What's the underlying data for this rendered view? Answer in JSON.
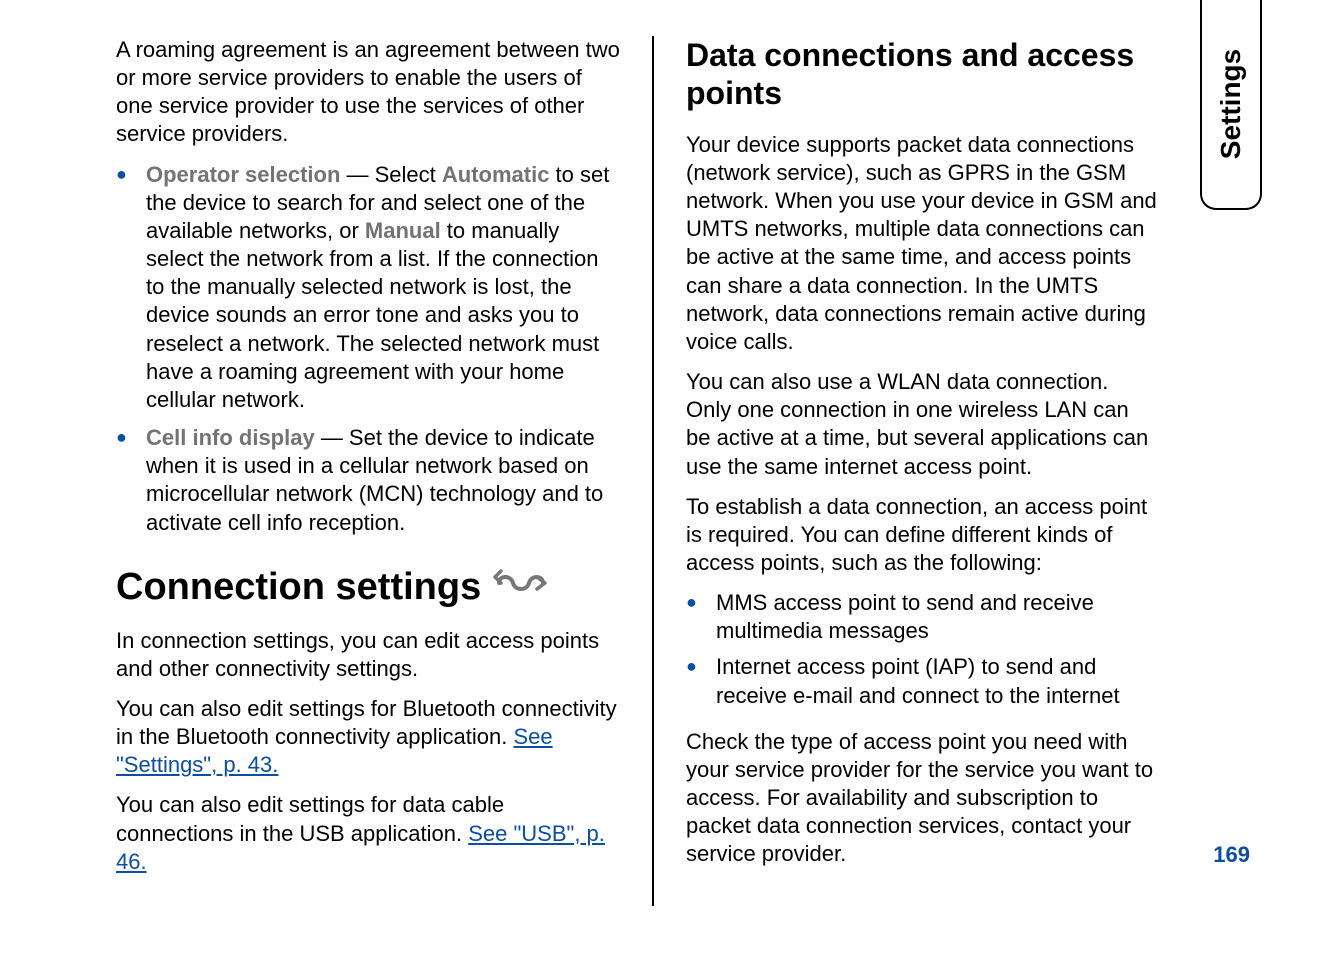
{
  "sideTab": "Settings",
  "pageNumber": "169",
  "left": {
    "roamingPara": "A roaming agreement is an agreement between two or more service providers to enable the users of one service provider to use the services of other service providers.",
    "bullets": [
      {
        "term": "Operator selection",
        "sep": " — Select ",
        "kw1": "Automatic",
        "mid": " to set the device to search for and select one of the available networks, or ",
        "kw2": "Manual",
        "tail": " to manually select the network from a list. If the connection to the manually selected network is lost, the device sounds an error tone and asks you to reselect a network. The selected network must have a roaming agreement with your home cellular network."
      },
      {
        "term": "Cell info display",
        "sep": " — Set the device to indicate when it is used in a cellular network based on microcellular network (MCN) technology and to activate cell info reception."
      }
    ],
    "connHeading": "Connection settings",
    "connPara1": "In connection settings, you can edit access points and other connectivity settings.",
    "connPara2_pre": "You can also edit settings for Bluetooth connectivity in the Bluetooth connectivity application. ",
    "connPara2_link": "See \"Settings\", p. 43.",
    "connPara3_pre": "You can also edit settings for data cable connections in the USB application. ",
    "connPara3_link": "See \"USB\", p. 46."
  },
  "right": {
    "heading": "Data connections and access points",
    "p1": "Your device supports packet data connections (network service), such as GPRS in the GSM network. When you use your device in GSM and UMTS networks, multiple data connections can be active at the same time, and access points can share a data connection. In the UMTS network, data connections remain active during voice calls.",
    "p2": "You can also use a WLAN data connection. Only one connection in one wireless LAN can be active at a time, but several applications can use the same internet access point.",
    "p3": "To establish a data connection, an access point is required. You can define different kinds of access points, such as the following:",
    "bullets": [
      "MMS access point to send and receive multimedia messages",
      "Internet access point (IAP) to send and receive e-mail and connect to the internet"
    ],
    "p4": "Check the type of access point you need with your service provider for the service you want to access. For availability and subscription to packet data connection services, contact your service provider."
  }
}
